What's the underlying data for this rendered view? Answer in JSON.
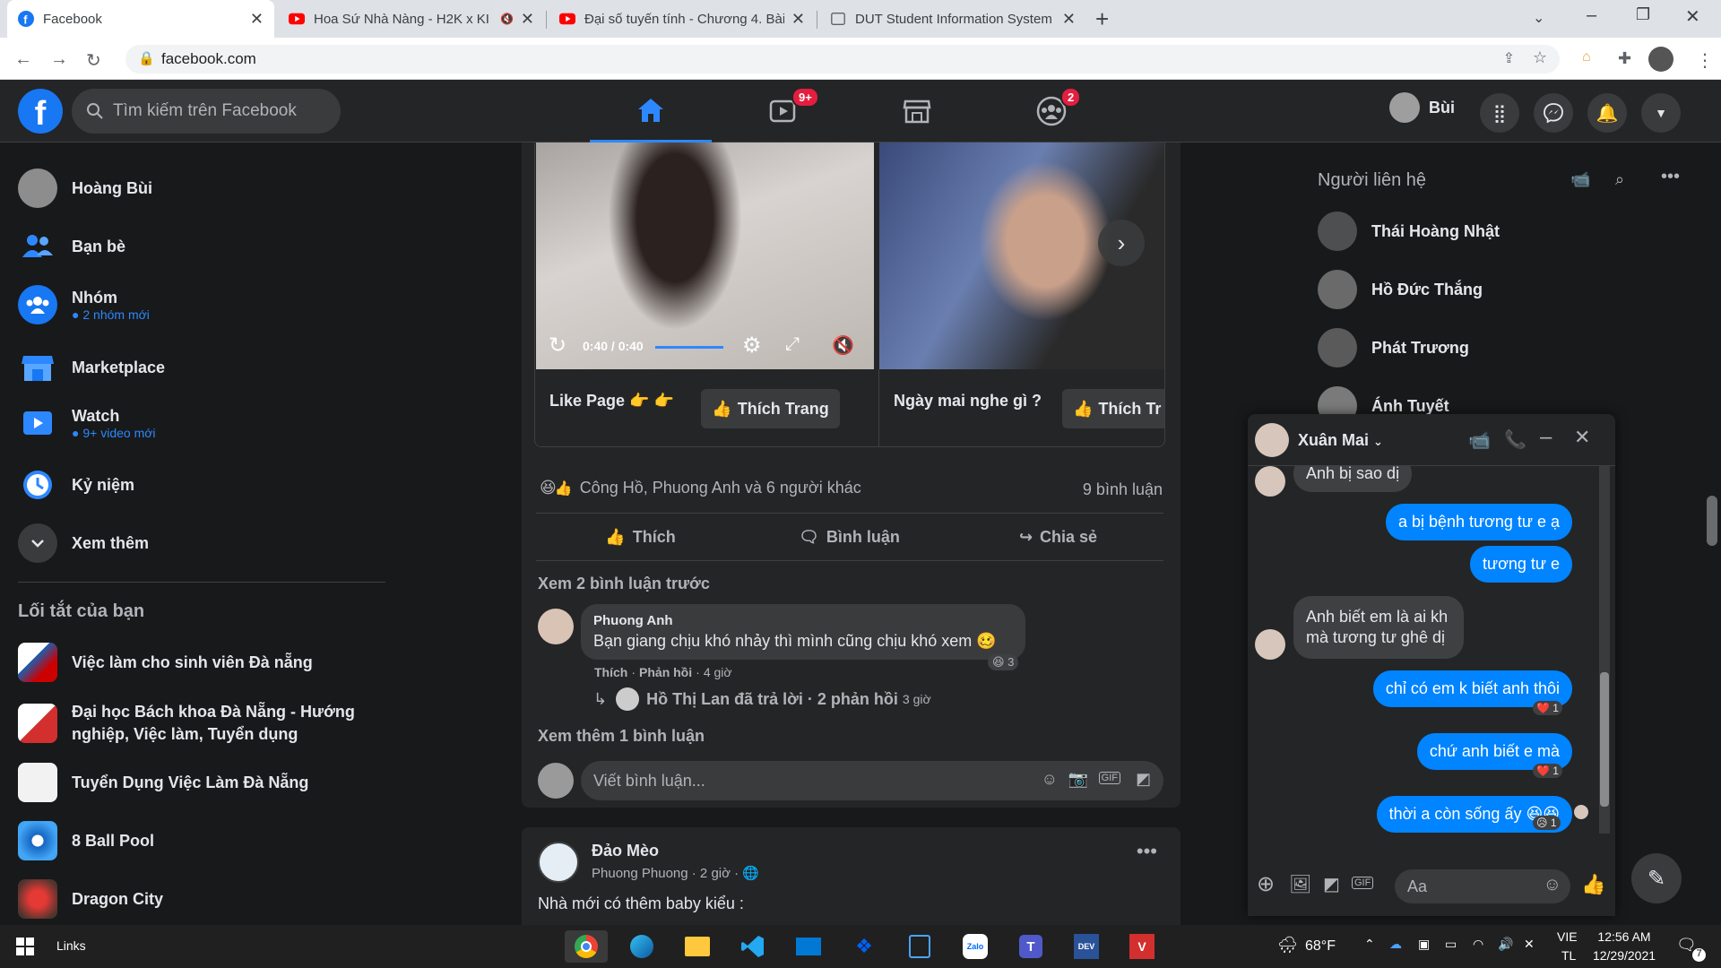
{
  "browser": {
    "tabs": [
      {
        "title": "Facebook",
        "active": true
      },
      {
        "title": "Hoa Sứ Nhà Nàng - H2K x KI",
        "muted": true
      },
      {
        "title": "Đại số tuyến tính - Chương 4. Bài"
      },
      {
        "title": "DUT Student Information System"
      }
    ],
    "url": "facebook.com"
  },
  "fb_header": {
    "search_placeholder": "Tìm kiếm trên Facebook",
    "watch_badge": "9+",
    "groups_badge": "2",
    "profile_name": "Bùi"
  },
  "left_sidebar": {
    "profile": "Hoàng Bùi",
    "items": [
      {
        "label": "Bạn bè"
      },
      {
        "label": "Nhóm",
        "sub": "2 nhóm mới"
      },
      {
        "label": "Marketplace"
      },
      {
        "label": "Watch",
        "sub": "9+ video mới"
      },
      {
        "label": "Kỷ niệm"
      },
      {
        "label": "Xem thêm"
      }
    ],
    "shortcuts_title": "Lối tắt của bạn",
    "shortcuts": [
      "Việc làm cho sinh viên Đà nẵng",
      "Đại học Bách khoa Đà Nẵng - Hướng nghiệp, Việc làm, Tuyển dụng",
      "Tuyển Dụng Việc Làm Đà Nẵng",
      "8 Ball Pool",
      "Dragon City"
    ]
  },
  "post1": {
    "video_time": "0:40 / 0:40",
    "video_progress": 1.0,
    "page1_caption": "Like Page 👉 👉",
    "page2_caption": "Ngày mai nghe gì ?",
    "like_page_btn": "Thích Trang",
    "like_page_btn2": "Thích Tr",
    "reactions_text": "Công Hồ, Phuong Anh và 6 người khác",
    "comments_count": "9 bình luận",
    "like_btn": "Thích",
    "comment_btn": "Bình luận",
    "share_btn": "Chia sẻ",
    "prev_comments": "Xem 2 bình luận trước",
    "comment": {
      "author": "Phuong Anh",
      "text": "Bạn giang chịu khó nhảy thì mình cũng chịu khó xem 🥴",
      "react_count": "3",
      "like": "Thích",
      "reply": "Phản hồi",
      "time": "4 giờ"
    },
    "reply_summary": "Hồ Thị Lan đã trả lời · 2 phản hồi",
    "reply_time": "3 giờ",
    "more_comments": "Xem thêm 1 bình luận",
    "comment_placeholder": "Viết bình luận..."
  },
  "post2": {
    "author": "Đảo Mèo",
    "meta": "Phuong Phuong · 2 giờ ·",
    "text": "Nhà mới có thêm baby kiểu :"
  },
  "contacts": {
    "title": "Người liên hệ",
    "list": [
      "Thái Hoàng Nhật",
      "Hồ Đức Thắng",
      "Phát Trương",
      "Ánh Tuyết"
    ]
  },
  "chat": {
    "name": "Xuân Mai",
    "messages": [
      {
        "from": "them",
        "text": "Anh bị sao dị"
      },
      {
        "from": "me",
        "text": "a bị bệnh tương tư e ạ"
      },
      {
        "from": "me",
        "text": "tương tư e"
      },
      {
        "from": "them",
        "text": "Anh biết em là ai kh mà tương tư ghê dị"
      },
      {
        "from": "me",
        "text": "chỉ có em k biết anh thôi",
        "react": "❤️ 1"
      },
      {
        "from": "me",
        "text": "chứ anh biết e mà",
        "react": "❤️ 1"
      },
      {
        "from": "me",
        "text": "thời a còn sống ấy 😆😆",
        "react": "😥 1"
      }
    ],
    "input_placeholder": "Aa"
  },
  "taskbar": {
    "links": "Links",
    "weather": "68°F",
    "lang1": "VIE",
    "lang2": "TL",
    "time": "12:56 AM",
    "date": "12/29/2021",
    "notif": "7"
  },
  "colors": {
    "fb_blue": "#1877f2",
    "messenger_blue": "#0084ff",
    "badge_red": "#e41e3f",
    "dark_bg": "#18191a",
    "card_bg": "#242526"
  }
}
